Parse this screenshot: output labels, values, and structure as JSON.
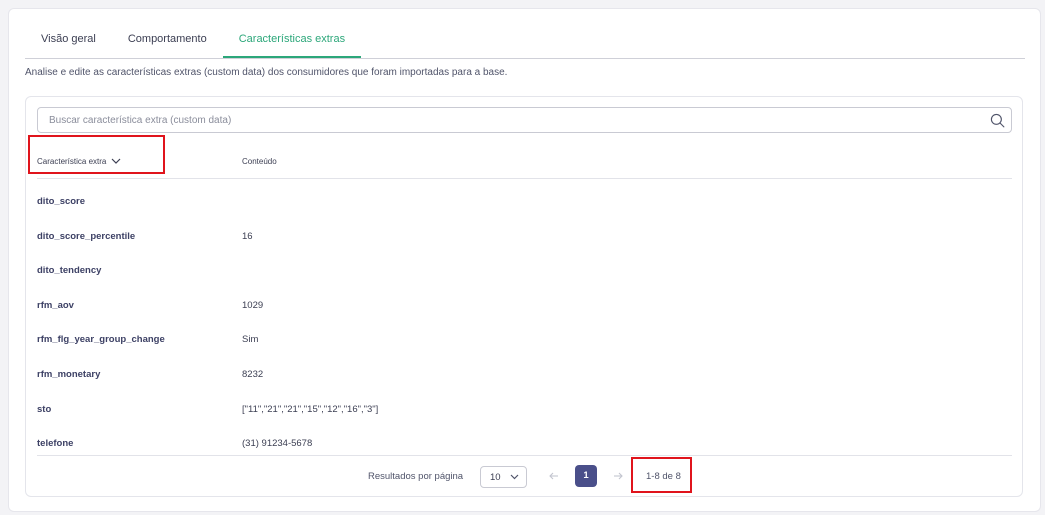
{
  "tabs": [
    {
      "label": "Visão geral",
      "active": false
    },
    {
      "label": "Comportamento",
      "active": false
    },
    {
      "label": "Características extras",
      "active": true
    }
  ],
  "description": "Analise e edite as características extras (custom data) dos consumidores que foram importadas para a base.",
  "search": {
    "placeholder": "Buscar característica extra (custom data)",
    "value": ""
  },
  "table": {
    "headers": {
      "key": "Característica extra",
      "value": "Conteúdo"
    },
    "rows": [
      {
        "key": "dito_score",
        "value": ""
      },
      {
        "key": "dito_score_percentile",
        "value": "16"
      },
      {
        "key": "dito_tendency",
        "value": ""
      },
      {
        "key": "rfm_aov",
        "value": "1029"
      },
      {
        "key": "rfm_flg_year_group_change",
        "value": "Sim"
      },
      {
        "key": "rfm_monetary",
        "value": "8232"
      },
      {
        "key": "sto",
        "value": "[\"11\",\"21\",\"21\",\"15\",\"12\",\"16\",\"3\"]"
      },
      {
        "key": "telefone",
        "value": "(31) 91234-5678"
      }
    ]
  },
  "pagination": {
    "per_page_label": "Resultados por página",
    "per_page_value": "10",
    "current_page": "1",
    "range": "1-8 de 8"
  },
  "colors": {
    "accent": "#2ca77a",
    "primary": "#4a4f8a",
    "highlight": "#e0141c"
  }
}
